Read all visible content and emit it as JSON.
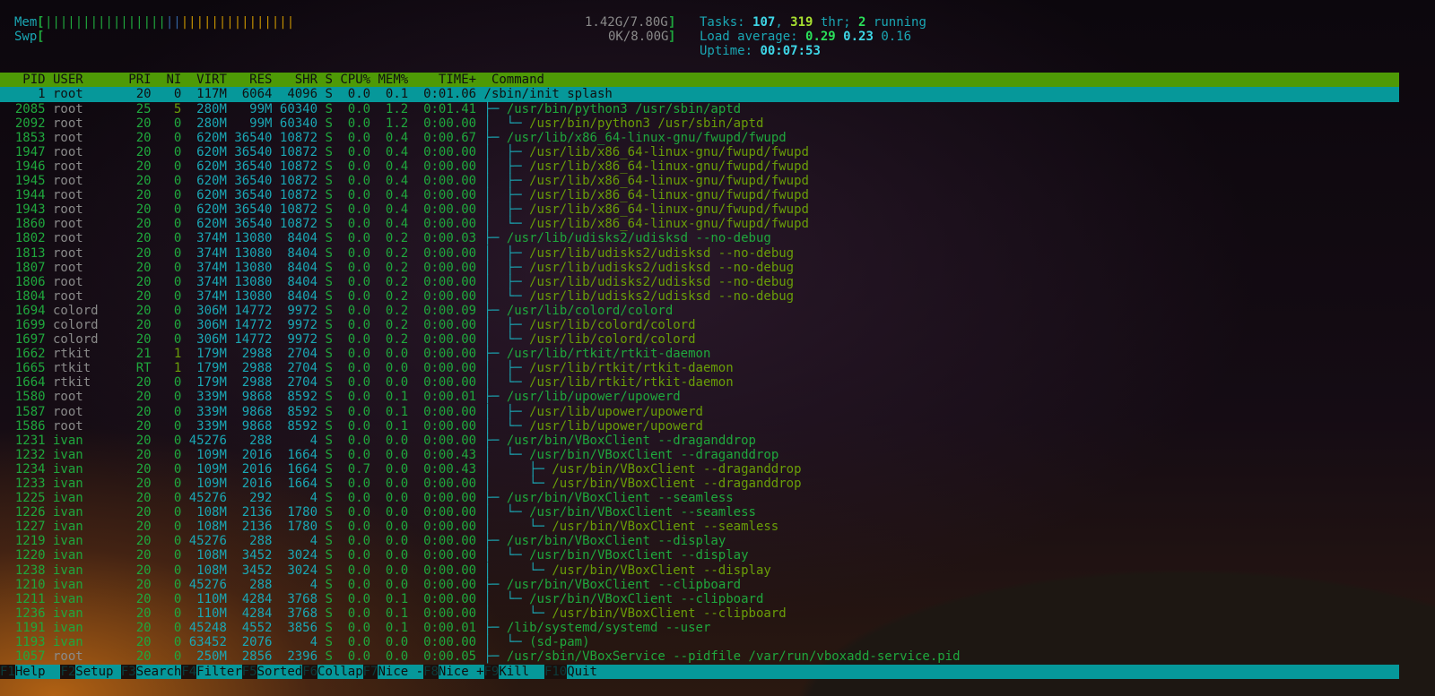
{
  "meters": {
    "mem_label": "Mem",
    "mem_value": "1.42G/7.80G",
    "mem_bars": {
      "used": 16,
      "buffers": 2,
      "cache": 15
    },
    "swp_label": "Swp",
    "swp_value": "0K/8.00G",
    "tasks_label": "Tasks: ",
    "tasks": "107",
    "thr": "319",
    "thr_label": " thr; ",
    "running": "2",
    "running_label": " running",
    "load_label": "Load average: ",
    "load1": "0.29",
    "load5": "0.23",
    "load15": "0.16",
    "uptime_label": "Uptime: ",
    "uptime": "00:07:53"
  },
  "columns": [
    "PID",
    "USER",
    "PRI",
    "NI",
    "VIRT",
    "RES",
    "SHR",
    "S",
    "CPU%",
    "MEM%",
    "TIME+",
    "Command"
  ],
  "rows": [
    {
      "pid": "1",
      "user": "root",
      "pri": "20",
      "ni": "0",
      "virt": "117M",
      "res": "6064",
      "shr": "4096",
      "s": "S",
      "cpu": "0.0",
      "mem": "0.1",
      "time": "0:01.06",
      "tree": "",
      "cmd": "/sbin/init splash",
      "selected": true
    },
    {
      "pid": "2085",
      "user": "root",
      "pri": "25",
      "ni": "5",
      "virt": "280M",
      "res": "99M",
      "shr": "60340",
      "s": "S",
      "cpu": "0.0",
      "mem": "1.2",
      "time": "0:01.41",
      "tree": "├─ ",
      "cmd": "/usr/bin/python3 /usr/sbin/aptd"
    },
    {
      "pid": "2092",
      "user": "root",
      "pri": "20",
      "ni": "0",
      "virt": "280M",
      "res": "99M",
      "shr": "60340",
      "s": "S",
      "cpu": "0.0",
      "mem": "1.2",
      "time": "0:00.00",
      "tree": "│  └─ ",
      "cmd": "/usr/bin/python3 /usr/sbin/aptd",
      "thread": true
    },
    {
      "pid": "1853",
      "user": "root",
      "pri": "20",
      "ni": "0",
      "virt": "620M",
      "res": "36540",
      "shr": "10872",
      "s": "S",
      "cpu": "0.0",
      "mem": "0.4",
      "time": "0:00.67",
      "tree": "├─ ",
      "cmd": "/usr/lib/x86_64-linux-gnu/fwupd/fwupd"
    },
    {
      "pid": "1947",
      "user": "root",
      "pri": "20",
      "ni": "0",
      "virt": "620M",
      "res": "36540",
      "shr": "10872",
      "s": "S",
      "cpu": "0.0",
      "mem": "0.4",
      "time": "0:00.00",
      "tree": "│  ├─ ",
      "cmd": "/usr/lib/x86_64-linux-gnu/fwupd/fwupd",
      "thread": true
    },
    {
      "pid": "1946",
      "user": "root",
      "pri": "20",
      "ni": "0",
      "virt": "620M",
      "res": "36540",
      "shr": "10872",
      "s": "S",
      "cpu": "0.0",
      "mem": "0.4",
      "time": "0:00.00",
      "tree": "│  ├─ ",
      "cmd": "/usr/lib/x86_64-linux-gnu/fwupd/fwupd",
      "thread": true
    },
    {
      "pid": "1945",
      "user": "root",
      "pri": "20",
      "ni": "0",
      "virt": "620M",
      "res": "36540",
      "shr": "10872",
      "s": "S",
      "cpu": "0.0",
      "mem": "0.4",
      "time": "0:00.00",
      "tree": "│  ├─ ",
      "cmd": "/usr/lib/x86_64-linux-gnu/fwupd/fwupd",
      "thread": true
    },
    {
      "pid": "1944",
      "user": "root",
      "pri": "20",
      "ni": "0",
      "virt": "620M",
      "res": "36540",
      "shr": "10872",
      "s": "S",
      "cpu": "0.0",
      "mem": "0.4",
      "time": "0:00.00",
      "tree": "│  ├─ ",
      "cmd": "/usr/lib/x86_64-linux-gnu/fwupd/fwupd",
      "thread": true
    },
    {
      "pid": "1943",
      "user": "root",
      "pri": "20",
      "ni": "0",
      "virt": "620M",
      "res": "36540",
      "shr": "10872",
      "s": "S",
      "cpu": "0.0",
      "mem": "0.4",
      "time": "0:00.00",
      "tree": "│  ├─ ",
      "cmd": "/usr/lib/x86_64-linux-gnu/fwupd/fwupd",
      "thread": true
    },
    {
      "pid": "1860",
      "user": "root",
      "pri": "20",
      "ni": "0",
      "virt": "620M",
      "res": "36540",
      "shr": "10872",
      "s": "S",
      "cpu": "0.0",
      "mem": "0.4",
      "time": "0:00.00",
      "tree": "│  └─ ",
      "cmd": "/usr/lib/x86_64-linux-gnu/fwupd/fwupd",
      "thread": true
    },
    {
      "pid": "1802",
      "user": "root",
      "pri": "20",
      "ni": "0",
      "virt": "374M",
      "res": "13080",
      "shr": "8404",
      "s": "S",
      "cpu": "0.0",
      "mem": "0.2",
      "time": "0:00.03",
      "tree": "├─ ",
      "cmd": "/usr/lib/udisks2/udisksd --no-debug"
    },
    {
      "pid": "1813",
      "user": "root",
      "pri": "20",
      "ni": "0",
      "virt": "374M",
      "res": "13080",
      "shr": "8404",
      "s": "S",
      "cpu": "0.0",
      "mem": "0.2",
      "time": "0:00.00",
      "tree": "│  ├─ ",
      "cmd": "/usr/lib/udisks2/udisksd --no-debug",
      "thread": true
    },
    {
      "pid": "1807",
      "user": "root",
      "pri": "20",
      "ni": "0",
      "virt": "374M",
      "res": "13080",
      "shr": "8404",
      "s": "S",
      "cpu": "0.0",
      "mem": "0.2",
      "time": "0:00.00",
      "tree": "│  ├─ ",
      "cmd": "/usr/lib/udisks2/udisksd --no-debug",
      "thread": true
    },
    {
      "pid": "1806",
      "user": "root",
      "pri": "20",
      "ni": "0",
      "virt": "374M",
      "res": "13080",
      "shr": "8404",
      "s": "S",
      "cpu": "0.0",
      "mem": "0.2",
      "time": "0:00.00",
      "tree": "│  ├─ ",
      "cmd": "/usr/lib/udisks2/udisksd --no-debug",
      "thread": true
    },
    {
      "pid": "1804",
      "user": "root",
      "pri": "20",
      "ni": "0",
      "virt": "374M",
      "res": "13080",
      "shr": "8404",
      "s": "S",
      "cpu": "0.0",
      "mem": "0.2",
      "time": "0:00.00",
      "tree": "│  └─ ",
      "cmd": "/usr/lib/udisks2/udisksd --no-debug",
      "thread": true
    },
    {
      "pid": "1694",
      "user": "colord",
      "pri": "20",
      "ni": "0",
      "virt": "306M",
      "res": "14772",
      "shr": "9972",
      "s": "S",
      "cpu": "0.0",
      "mem": "0.2",
      "time": "0:00.09",
      "tree": "├─ ",
      "cmd": "/usr/lib/colord/colord"
    },
    {
      "pid": "1699",
      "user": "colord",
      "pri": "20",
      "ni": "0",
      "virt": "306M",
      "res": "14772",
      "shr": "9972",
      "s": "S",
      "cpu": "0.0",
      "mem": "0.2",
      "time": "0:00.00",
      "tree": "│  ├─ ",
      "cmd": "/usr/lib/colord/colord",
      "thread": true
    },
    {
      "pid": "1697",
      "user": "colord",
      "pri": "20",
      "ni": "0",
      "virt": "306M",
      "res": "14772",
      "shr": "9972",
      "s": "S",
      "cpu": "0.0",
      "mem": "0.2",
      "time": "0:00.00",
      "tree": "│  └─ ",
      "cmd": "/usr/lib/colord/colord",
      "thread": true
    },
    {
      "pid": "1662",
      "user": "rtkit",
      "pri": "21",
      "ni": "1",
      "virt": "179M",
      "res": "2988",
      "shr": "2704",
      "s": "S",
      "cpu": "0.0",
      "mem": "0.0",
      "time": "0:00.00",
      "tree": "├─ ",
      "cmd": "/usr/lib/rtkit/rtkit-daemon"
    },
    {
      "pid": "1665",
      "user": "rtkit",
      "pri": "RT",
      "ni": "1",
      "virt": "179M",
      "res": "2988",
      "shr": "2704",
      "s": "S",
      "cpu": "0.0",
      "mem": "0.0",
      "time": "0:00.00",
      "tree": "│  ├─ ",
      "cmd": "/usr/lib/rtkit/rtkit-daemon",
      "thread": true
    },
    {
      "pid": "1664",
      "user": "rtkit",
      "pri": "20",
      "ni": "0",
      "virt": "179M",
      "res": "2988",
      "shr": "2704",
      "s": "S",
      "cpu": "0.0",
      "mem": "0.0",
      "time": "0:00.00",
      "tree": "│  └─ ",
      "cmd": "/usr/lib/rtkit/rtkit-daemon",
      "thread": true
    },
    {
      "pid": "1580",
      "user": "root",
      "pri": "20",
      "ni": "0",
      "virt": "339M",
      "res": "9868",
      "shr": "8592",
      "s": "S",
      "cpu": "0.0",
      "mem": "0.1",
      "time": "0:00.01",
      "tree": "├─ ",
      "cmd": "/usr/lib/upower/upowerd"
    },
    {
      "pid": "1587",
      "user": "root",
      "pri": "20",
      "ni": "0",
      "virt": "339M",
      "res": "9868",
      "shr": "8592",
      "s": "S",
      "cpu": "0.0",
      "mem": "0.1",
      "time": "0:00.00",
      "tree": "│  ├─ ",
      "cmd": "/usr/lib/upower/upowerd",
      "thread": true
    },
    {
      "pid": "1586",
      "user": "root",
      "pri": "20",
      "ni": "0",
      "virt": "339M",
      "res": "9868",
      "shr": "8592",
      "s": "S",
      "cpu": "0.0",
      "mem": "0.1",
      "time": "0:00.00",
      "tree": "│  └─ ",
      "cmd": "/usr/lib/upower/upowerd",
      "thread": true
    },
    {
      "pid": "1231",
      "user": "ivan",
      "pri": "20",
      "ni": "0",
      "virt": "45276",
      "res": "288",
      "shr": "4",
      "s": "S",
      "cpu": "0.0",
      "mem": "0.0",
      "time": "0:00.00",
      "tree": "├─ ",
      "cmd": "/usr/bin/VBoxClient --draganddrop"
    },
    {
      "pid": "1232",
      "user": "ivan",
      "pri": "20",
      "ni": "0",
      "virt": "109M",
      "res": "2016",
      "shr": "1664",
      "s": "S",
      "cpu": "0.0",
      "mem": "0.0",
      "time": "0:00.43",
      "tree": "│  └─ ",
      "cmd": "/usr/bin/VBoxClient --draganddrop"
    },
    {
      "pid": "1234",
      "user": "ivan",
      "pri": "20",
      "ni": "0",
      "virt": "109M",
      "res": "2016",
      "shr": "1664",
      "s": "S",
      "cpu": "0.7",
      "mem": "0.0",
      "time": "0:00.43",
      "tree": "│     ├─ ",
      "cmd": "/usr/bin/VBoxClient --draganddrop",
      "thread": true
    },
    {
      "pid": "1233",
      "user": "ivan",
      "pri": "20",
      "ni": "0",
      "virt": "109M",
      "res": "2016",
      "shr": "1664",
      "s": "S",
      "cpu": "0.0",
      "mem": "0.0",
      "time": "0:00.00",
      "tree": "│     └─ ",
      "cmd": "/usr/bin/VBoxClient --draganddrop",
      "thread": true
    },
    {
      "pid": "1225",
      "user": "ivan",
      "pri": "20",
      "ni": "0",
      "virt": "45276",
      "res": "292",
      "shr": "4",
      "s": "S",
      "cpu": "0.0",
      "mem": "0.0",
      "time": "0:00.00",
      "tree": "├─ ",
      "cmd": "/usr/bin/VBoxClient --seamless"
    },
    {
      "pid": "1226",
      "user": "ivan",
      "pri": "20",
      "ni": "0",
      "virt": "108M",
      "res": "2136",
      "shr": "1780",
      "s": "S",
      "cpu": "0.0",
      "mem": "0.0",
      "time": "0:00.00",
      "tree": "│  └─ ",
      "cmd": "/usr/bin/VBoxClient --seamless"
    },
    {
      "pid": "1227",
      "user": "ivan",
      "pri": "20",
      "ni": "0",
      "virt": "108M",
      "res": "2136",
      "shr": "1780",
      "s": "S",
      "cpu": "0.0",
      "mem": "0.0",
      "time": "0:00.00",
      "tree": "│     └─ ",
      "cmd": "/usr/bin/VBoxClient --seamless",
      "thread": true
    },
    {
      "pid": "1219",
      "user": "ivan",
      "pri": "20",
      "ni": "0",
      "virt": "45276",
      "res": "288",
      "shr": "4",
      "s": "S",
      "cpu": "0.0",
      "mem": "0.0",
      "time": "0:00.00",
      "tree": "├─ ",
      "cmd": "/usr/bin/VBoxClient --display"
    },
    {
      "pid": "1220",
      "user": "ivan",
      "pri": "20",
      "ni": "0",
      "virt": "108M",
      "res": "3452",
      "shr": "3024",
      "s": "S",
      "cpu": "0.0",
      "mem": "0.0",
      "time": "0:00.00",
      "tree": "│  └─ ",
      "cmd": "/usr/bin/VBoxClient --display"
    },
    {
      "pid": "1238",
      "user": "ivan",
      "pri": "20",
      "ni": "0",
      "virt": "108M",
      "res": "3452",
      "shr": "3024",
      "s": "S",
      "cpu": "0.0",
      "mem": "0.0",
      "time": "0:00.00",
      "tree": "│     └─ ",
      "cmd": "/usr/bin/VBoxClient --display",
      "thread": true
    },
    {
      "pid": "1210",
      "user": "ivan",
      "pri": "20",
      "ni": "0",
      "virt": "45276",
      "res": "288",
      "shr": "4",
      "s": "S",
      "cpu": "0.0",
      "mem": "0.0",
      "time": "0:00.00",
      "tree": "├─ ",
      "cmd": "/usr/bin/VBoxClient --clipboard"
    },
    {
      "pid": "1211",
      "user": "ivan",
      "pri": "20",
      "ni": "0",
      "virt": "110M",
      "res": "4284",
      "shr": "3768",
      "s": "S",
      "cpu": "0.0",
      "mem": "0.1",
      "time": "0:00.00",
      "tree": "│  └─ ",
      "cmd": "/usr/bin/VBoxClient --clipboard"
    },
    {
      "pid": "1236",
      "user": "ivan",
      "pri": "20",
      "ni": "0",
      "virt": "110M",
      "res": "4284",
      "shr": "3768",
      "s": "S",
      "cpu": "0.0",
      "mem": "0.1",
      "time": "0:00.00",
      "tree": "│     └─ ",
      "cmd": "/usr/bin/VBoxClient --clipboard",
      "thread": true
    },
    {
      "pid": "1191",
      "user": "ivan",
      "pri": "20",
      "ni": "0",
      "virt": "45248",
      "res": "4552",
      "shr": "3856",
      "s": "S",
      "cpu": "0.0",
      "mem": "0.1",
      "time": "0:00.01",
      "tree": "├─ ",
      "cmd": "/lib/systemd/systemd --user"
    },
    {
      "pid": "1193",
      "user": "ivan",
      "pri": "20",
      "ni": "0",
      "virt": "63452",
      "res": "2076",
      "shr": "4",
      "s": "S",
      "cpu": "0.0",
      "mem": "0.0",
      "time": "0:00.00",
      "tree": "│  └─ ",
      "cmd": "(sd-pam)"
    },
    {
      "pid": "1057",
      "user": "root",
      "pri": "20",
      "ni": "0",
      "virt": "250M",
      "res": "2856",
      "shr": "2396",
      "s": "S",
      "cpu": "0.0",
      "mem": "0.0",
      "time": "0:00.05",
      "tree": "├─ ",
      "cmd": "/usr/sbin/VBoxService --pidfile /var/run/vboxadd-service.pid"
    }
  ],
  "footer": [
    {
      "key": "F1",
      "label": "Help  "
    },
    {
      "key": "F2",
      "label": "Setup "
    },
    {
      "key": "F3",
      "label": "Search"
    },
    {
      "key": "F4",
      "label": "Filter"
    },
    {
      "key": "F5",
      "label": "Sorted"
    },
    {
      "key": "F6",
      "label": "Collap"
    },
    {
      "key": "F7",
      "label": "Nice -"
    },
    {
      "key": "F8",
      "label": "Nice +"
    },
    {
      "key": "F9",
      "label": "Kill  "
    },
    {
      "key": "F10",
      "label": "Quit"
    }
  ]
}
